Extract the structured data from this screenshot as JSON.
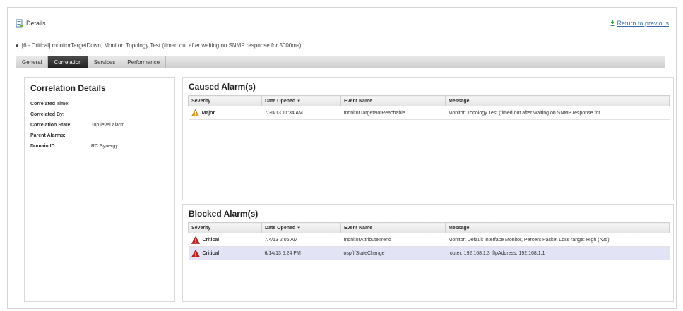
{
  "header": {
    "title": "Details",
    "return_link": "Return to previous",
    "alarm_summary": "[6 - Critical] monitorTargetDown, Monitor: Topology Test (timed out after waiting on SNMP response for 5000ms)"
  },
  "tabs": [
    {
      "label": "General"
    },
    {
      "label": "Correlation"
    },
    {
      "label": "Services"
    },
    {
      "label": "Performance"
    }
  ],
  "correlation": {
    "title": "Correlation Details",
    "rows": [
      {
        "key": "Correlated Time:",
        "value": ""
      },
      {
        "key": "Correlated By:",
        "value": ""
      },
      {
        "key": "Correlation State:",
        "value": "Top level alarm"
      },
      {
        "key": "Parent Alarms:",
        "value": ""
      },
      {
        "key": "Domain ID:",
        "value": "RC Synergy"
      }
    ]
  },
  "columns": {
    "severity": "Severity",
    "date_opened": "Date Opened",
    "event_name": "Event Name",
    "message": "Message"
  },
  "caused": {
    "title": "Caused Alarm(s)",
    "rows": [
      {
        "severity": "Major",
        "date": "7/30/13 11:34 AM",
        "event": "monitorTargetNotReachable",
        "message": "Monitor: Topology Test (timed out after waiting on SNMP response for ..."
      }
    ]
  },
  "blocked": {
    "title": "Blocked Alarm(s)",
    "rows": [
      {
        "severity": "Critical",
        "date": "7/4/13 2:06 AM",
        "event": "monitorAttributeTrend",
        "message": "Monitor: Default Interface Monitor, Percent Packet Loss range: High (>25)"
      },
      {
        "severity": "Critical",
        "date": "6/14/13 5:24 PM",
        "event": "ospfIfStateChange",
        "message": "router: 192.168.1.3 ifIpAddress: 192.168.1.1"
      }
    ]
  },
  "colors": {
    "major": "#f0a020",
    "critical": "#d02020",
    "selected_row": "#e3e3f6",
    "link": "#3a6db5"
  }
}
